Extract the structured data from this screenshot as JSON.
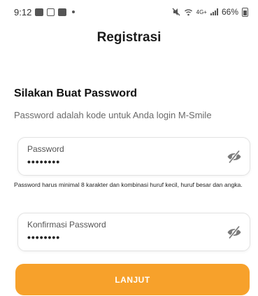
{
  "status_bar": {
    "time": "9:12",
    "network_label": "4G+",
    "battery": "66%",
    "left_icons": [
      "gallery-icon",
      "instagram-icon",
      "mail-icon"
    ],
    "right_icons": [
      "mute-icon",
      "wifi-icon",
      "signal-icon",
      "battery-icon"
    ]
  },
  "header": {
    "title": "Registrasi"
  },
  "section": {
    "heading": "Silakan Buat Password",
    "subtitle": "Password adalah kode untuk Anda login M-Smile"
  },
  "form": {
    "password": {
      "label": "Password",
      "value": "••••••••",
      "icon": "eye-off-icon"
    },
    "hint": "Password harus minimal 8 karakter dan kombinasi huruf kecil, huruf besar dan angka.",
    "confirm": {
      "label": "Konfirmasi Password",
      "value": "••••••••",
      "icon": "eye-off-icon"
    }
  },
  "actions": {
    "continue_label": "LANJUT"
  },
  "colors": {
    "accent": "#f7a12b",
    "text": "#1a1a1a",
    "muted": "#6a6a6a"
  }
}
